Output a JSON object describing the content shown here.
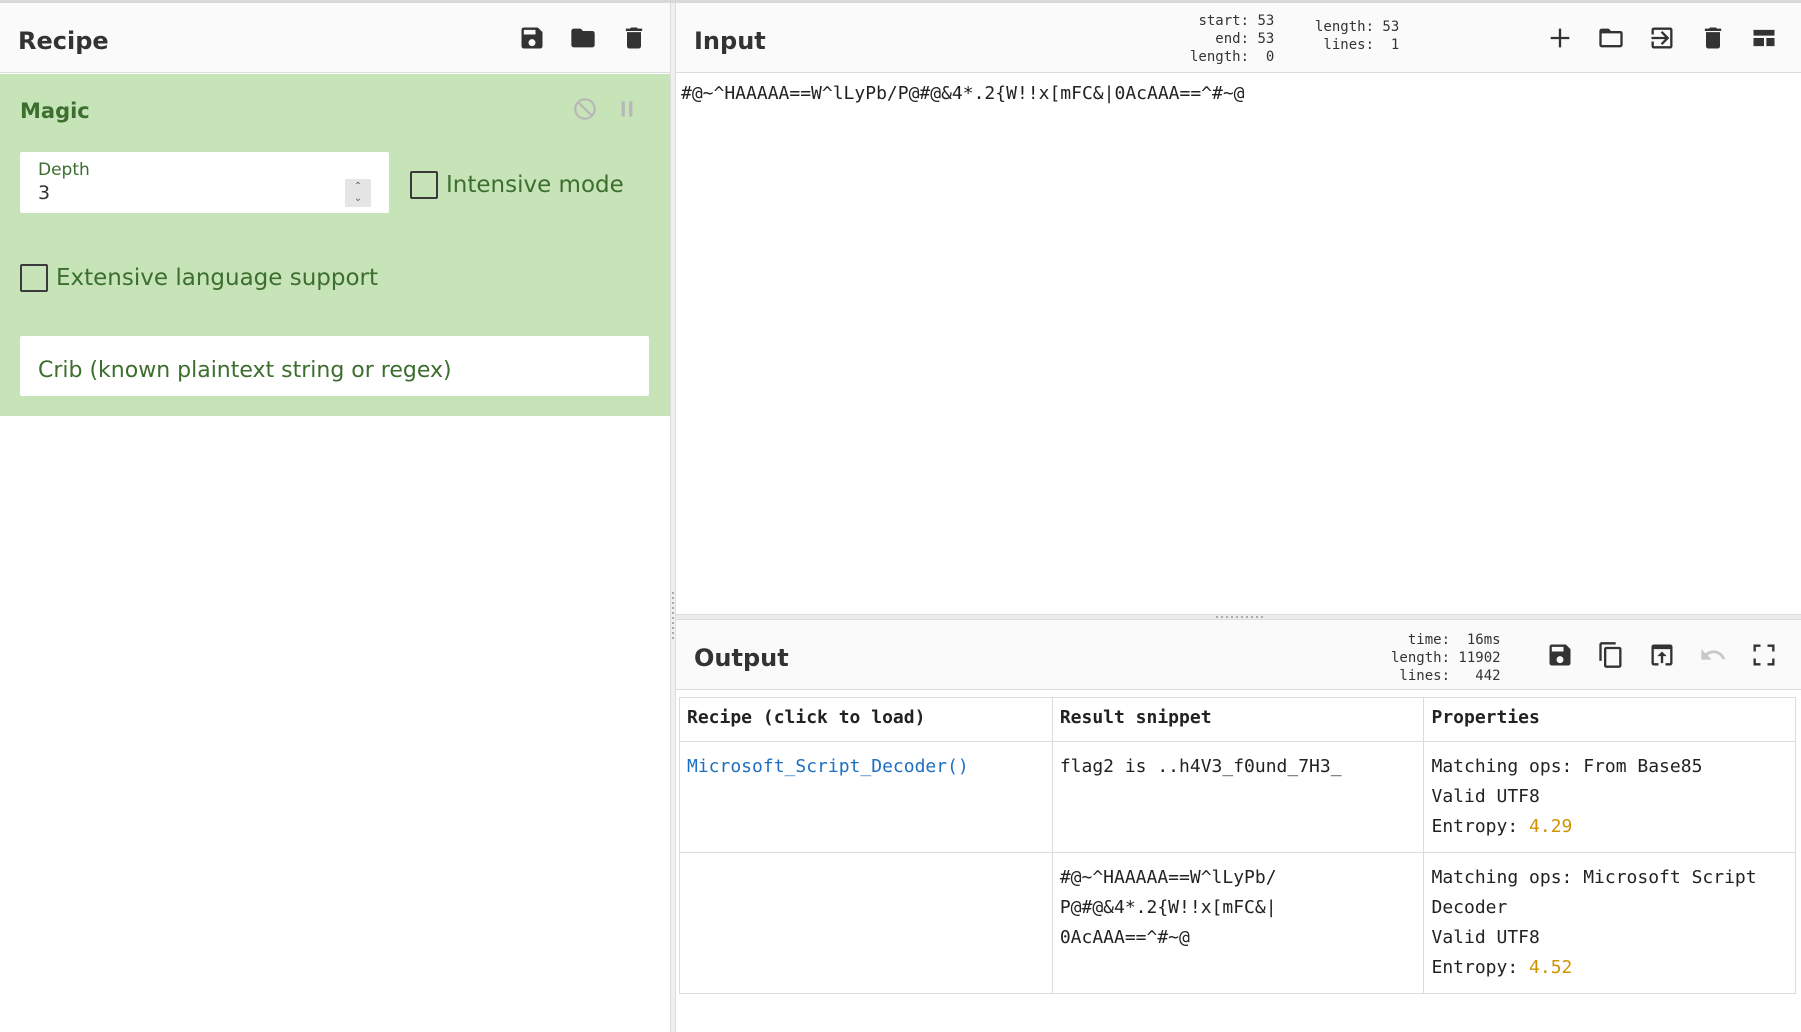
{
  "recipe": {
    "title": "Recipe",
    "icons": [
      "save-icon",
      "folder-icon",
      "trash-icon"
    ],
    "operation": {
      "name": "Magic",
      "depth_label": "Depth",
      "depth_value": "3",
      "intensive_label": "Intensive mode",
      "intensive_checked": false,
      "extensive_label": "Extensive language support",
      "extensive_checked": false,
      "crib_placeholder": "Crib (known plaintext string or regex)"
    }
  },
  "input": {
    "title": "Input",
    "stats_selection": "start: 53\n  end: 53\nlength:  0",
    "stats_total": "length: 53\n lines:  1",
    "text": "#@~^HAAAAA==W^lLyPb/P@#@&4*.2{W!!x[mFC&|0AcAAA==^#~@"
  },
  "output": {
    "title": "Output",
    "stats": "  time:  16ms\nlength: 11902\n lines:   442",
    "table": {
      "headers": [
        "Recipe (click to load)",
        "Result snippet",
        "Properties"
      ],
      "rows": [
        {
          "recipe": "Microsoft_Script_Decoder()",
          "snippet": "flag2 is ..h4V3_f0und_7H3_",
          "matching": "Matching ops: From Base85",
          "valid": "Valid UTF8",
          "entropy_label": "Entropy: ",
          "entropy_value": "4.29"
        },
        {
          "recipe": "",
          "snippet": "#@~^HAAAAA==W^lLyPb/\nP@#@&4*.2{W!!x[mFC&|\n0AcAAA==^#~@",
          "matching": "Matching ops: Microsoft Script Decoder",
          "valid": "Valid UTF8",
          "entropy_label": "Entropy: ",
          "entropy_value": "4.52"
        }
      ]
    }
  },
  "colors": {
    "operation_bg": "#c7e4b9",
    "operation_text": "#3c6e2e",
    "link": "#1d6fc2",
    "entropy": "#d19400"
  }
}
